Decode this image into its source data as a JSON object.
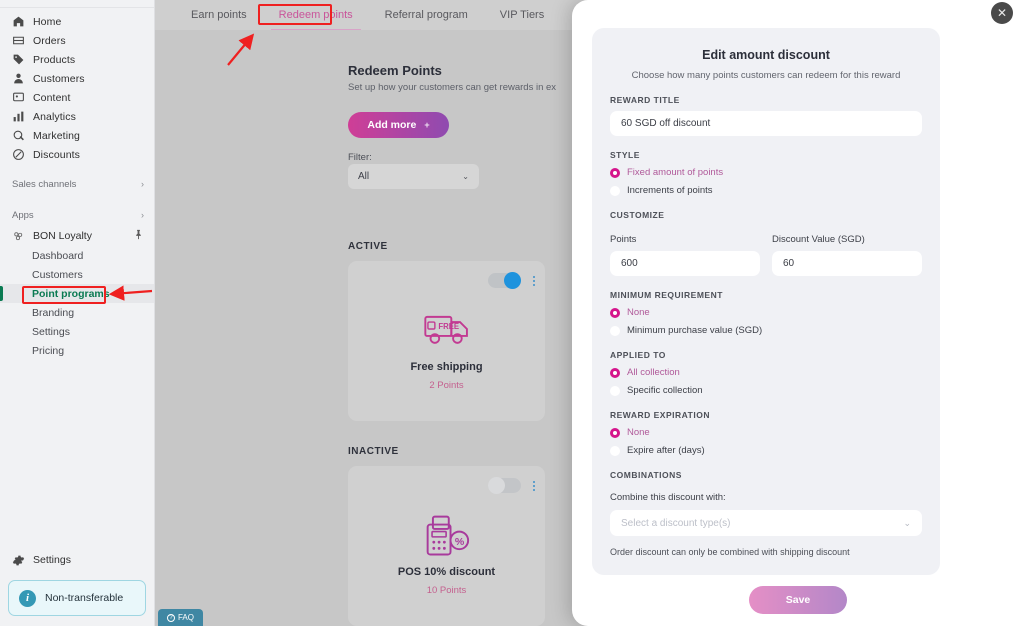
{
  "sidebar": {
    "nav_items": [
      {
        "label": "Home",
        "icon": "home-icon"
      },
      {
        "label": "Orders",
        "icon": "orders-icon"
      },
      {
        "label": "Products",
        "icon": "products-tag-icon"
      },
      {
        "label": "Customers",
        "icon": "customers-person-icon"
      },
      {
        "label": "Content",
        "icon": "content-icon"
      },
      {
        "label": "Analytics",
        "icon": "analytics-bars-icon"
      },
      {
        "label": "Marketing",
        "icon": "marketing-megaphone-icon"
      },
      {
        "label": "Discounts",
        "icon": "discounts-icon"
      }
    ],
    "sales_channels": {
      "label": "Sales channels",
      "chevron": "›"
    },
    "apps": {
      "label": "Apps",
      "chevron": "›"
    },
    "app": {
      "name": "BON Loyalty",
      "pin": "📌"
    },
    "sub_items": [
      {
        "label": "Dashboard",
        "active": false
      },
      {
        "label": "Customers",
        "active": false
      },
      {
        "label": "Point programs",
        "active": true
      },
      {
        "label": "Branding",
        "active": false
      },
      {
        "label": "Settings",
        "active": false
      },
      {
        "label": "Pricing",
        "active": false
      }
    ],
    "settings": {
      "label": "Settings",
      "icon": "gear-icon"
    },
    "non_transferable": {
      "label": "Non-transferable",
      "icon": "info-icon"
    }
  },
  "tabs": [
    {
      "label": "Earn points",
      "active": false
    },
    {
      "label": "Redeem points",
      "active": true
    },
    {
      "label": "Referral program",
      "active": false
    },
    {
      "label": "VIP Tiers",
      "active": false
    }
  ],
  "main": {
    "page_title": "Redeem Points",
    "page_subtitle": "Set up how your customers can get rewards in ex",
    "add_more_label": "Add more",
    "add_more_plus": "+",
    "filter_label": "Filter:",
    "filter_value": "All",
    "filter_chevron": "⌄",
    "section_active": "ACTIVE",
    "section_inactive": "INACTIVE",
    "cards": [
      {
        "name": "Free shipping",
        "points": "2 Points",
        "toggle": "on",
        "icon": "free-shipping-truck-icon"
      },
      {
        "name": "POS 10% discount",
        "points": "10 Points",
        "toggle": "off",
        "icon": "pos-terminal-percent-icon"
      }
    ],
    "faq_label": "FAQ"
  },
  "modal": {
    "title": "Edit amount discount",
    "subtitle": "Choose how many points customers can redeem for this reward",
    "close_label": "✕",
    "reward_title_label": "REWARD TITLE",
    "reward_title_value": "60 SGD off discount",
    "style_label": "STYLE",
    "style_options": [
      {
        "label": "Fixed amount of points",
        "selected": true
      },
      {
        "label": "Increments of points",
        "selected": false
      }
    ],
    "customize_label": "CUSTOMIZE",
    "points_label": "Points",
    "points_value": "600",
    "discount_value_label": "Discount Value (SGD)",
    "discount_value": "60",
    "minimum_requirement_label": "MINIMUM REQUIREMENT",
    "minimum_options": [
      {
        "label": "None",
        "selected": true
      },
      {
        "label": "Minimum purchase value (SGD)",
        "selected": false
      }
    ],
    "applied_to_label": "APPLIED TO",
    "applied_options": [
      {
        "label": "All collection",
        "selected": true
      },
      {
        "label": "Specific collection",
        "selected": false
      }
    ],
    "reward_expiration_label": "REWARD EXPIRATION",
    "expiration_options": [
      {
        "label": "None",
        "selected": true
      },
      {
        "label": "Expire after (days)",
        "selected": false
      }
    ],
    "combinations_label": "COMBINATIONS",
    "combine_label": "Combine this discount with:",
    "combine_placeholder": "Select a discount type(s)",
    "combine_chevron": "⌄",
    "combine_note": "Order discount can only be combined with shipping discount",
    "save_label": "Save"
  },
  "colors": {
    "accent_pink": "#d5158c",
    "tab_active": "#c9549a",
    "active_nav_green": "#0a7a52",
    "annotation_red": "#ef2020",
    "toggle_on_blue": "#1f93dd"
  }
}
